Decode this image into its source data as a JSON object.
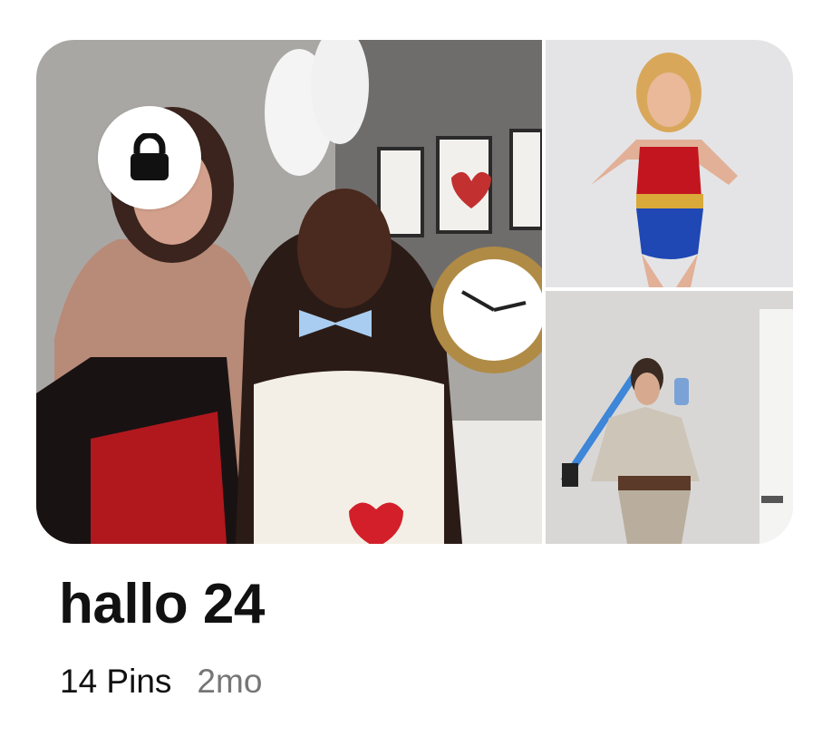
{
  "board": {
    "title": "hallo 24",
    "pin_count": "14 Pins",
    "updated": "2mo",
    "private": true
  },
  "icons": {
    "lock": "lock-icon"
  },
  "cover_images": [
    {
      "position": "main",
      "subject": "two friends in Queen of Hearts and White Rabbit costumes holding a clock"
    },
    {
      "position": "top-right",
      "subject": "model in Wonder Woman costume"
    },
    {
      "position": "bottom-right",
      "subject": "mirror selfie in Rey costume with lightsaber"
    }
  ],
  "colors": {
    "title_text": "#111111",
    "meta_text": "#111111",
    "age_text": "#767676",
    "lock_badge_bg": "#ffffff",
    "lock_icon": "#111111"
  }
}
